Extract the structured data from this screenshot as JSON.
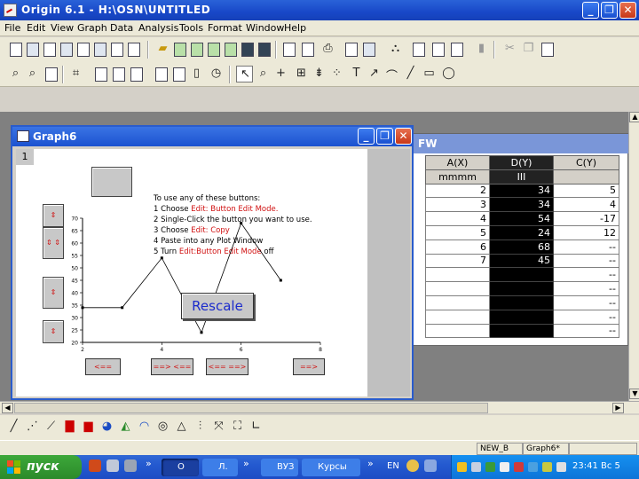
{
  "window": {
    "title": "Origin 6.1 - H:\\OSN\\UNTITLED"
  },
  "menu": [
    "File",
    "Edit",
    "View",
    "Graph",
    "Data",
    "Analysis",
    "Tools",
    "Format",
    "Window",
    "Help"
  ],
  "worksheet": {
    "title_fragment": "FW",
    "columns": [
      "A(X)",
      "D(Y)",
      "C(Y)"
    ],
    "subheader": [
      "mmmm",
      "III",
      ""
    ],
    "rows": [
      [
        "2",
        "34",
        "5"
      ],
      [
        "3",
        "34",
        "4"
      ],
      [
        "4",
        "54",
        "-17"
      ],
      [
        "5",
        "24",
        "12"
      ],
      [
        "6",
        "68",
        "--"
      ],
      [
        "7",
        "45",
        "--"
      ],
      [
        "",
        "",
        "--"
      ],
      [
        "",
        "",
        "--"
      ],
      [
        "",
        "",
        "--"
      ],
      [
        "",
        "",
        "--"
      ],
      [
        "",
        "",
        "--"
      ]
    ]
  },
  "graph": {
    "title": "Graph6",
    "layer": "1",
    "instructions": {
      "heading": "To use any of these buttons:",
      "steps": [
        {
          "n": "1",
          "plain": "Choose ",
          "red": "Edit: Button Edit Mode.",
          "after": ""
        },
        {
          "n": "2",
          "plain": "Single-Click the button you want to use.",
          "red": "",
          "after": ""
        },
        {
          "n": "3",
          "plain": "Choose ",
          "red": "Edit: Copy",
          "after": ""
        },
        {
          "n": "4",
          "plain": "Paste into any Plot Window",
          "red": "",
          "after": ""
        },
        {
          "n": "5",
          "plain": "Turn ",
          "red": "Edit:Button Edit Mode",
          "after": " off"
        }
      ]
    },
    "rescale_label": "Rescale",
    "side_buttons": [
      "⇕",
      "⇕ ⇕",
      "⇕",
      "⇕"
    ],
    "nav_buttons": [
      "<==",
      "==> <==",
      "<== ==>",
      "==>"
    ]
  },
  "chart_data": {
    "type": "line",
    "x": [
      2,
      3,
      4,
      5,
      6,
      7
    ],
    "values": [
      34,
      34,
      54,
      24,
      68,
      45
    ],
    "xlim": [
      2,
      8
    ],
    "ylim": [
      20,
      70
    ],
    "xticks": [
      "2",
      "4",
      "6",
      "8"
    ],
    "yticks": [
      "70",
      "65",
      "60",
      "55",
      "50",
      "45",
      "40",
      "35",
      "30",
      "25",
      "20"
    ]
  },
  "statusbar": [
    "NEW_B",
    "Graph6*"
  ],
  "taskbar": {
    "start": "пуск",
    "tasks": [
      "O",
      "Л.",
      "ВУЗ",
      "Курсы"
    ],
    "lang": "EN",
    "clock": "23:41 Вс 5"
  }
}
